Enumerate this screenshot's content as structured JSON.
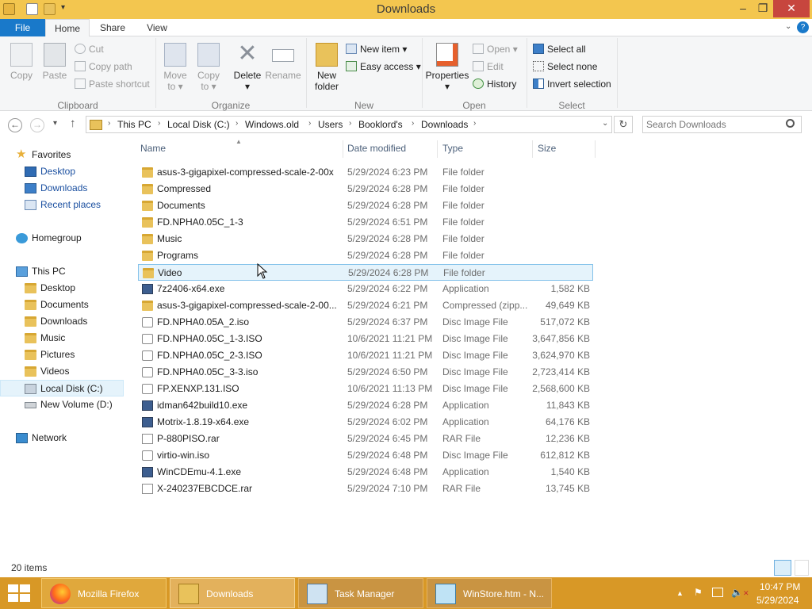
{
  "window": {
    "title": "Downloads",
    "minimize": "–",
    "maximize": "❐",
    "close": "✕"
  },
  "ribbon_tabs": [
    "File",
    "Home",
    "Share",
    "View"
  ],
  "help": "?",
  "ribbon": {
    "clipboard": {
      "copy": "Copy",
      "paste": "Paste",
      "cut": "Cut",
      "copy_path": "Copy path",
      "paste_shortcut": "Paste shortcut",
      "group": "Clipboard"
    },
    "organize": {
      "move_to_1": "Move",
      "move_to_2": "to",
      "copy_to_1": "Copy",
      "copy_to_2": "to",
      "delete": "Delete",
      "rename": "Rename",
      "group": "Organize"
    },
    "new": {
      "new_folder_1": "New",
      "new_folder_2": "folder",
      "new_item": "New item",
      "easy_access": "Easy access",
      "group": "New"
    },
    "open": {
      "properties": "Properties",
      "open": "Open",
      "edit": "Edit",
      "history": "History",
      "group": "Open"
    },
    "select": {
      "select_all": "Select all",
      "select_none": "Select none",
      "invert": "Invert selection",
      "group": "Select"
    }
  },
  "address": {
    "crumbs": [
      "This PC",
      "Local Disk (C:)",
      "Windows.old",
      "Users",
      "Booklord's",
      "Downloads"
    ],
    "search_placeholder": "Search Downloads"
  },
  "nav": {
    "favorites": "Favorites",
    "desktop": "Desktop",
    "downloads": "Downloads",
    "recent": "Recent places",
    "homegroup": "Homegroup",
    "thispc": "This PC",
    "pc_desktop": "Desktop",
    "pc_documents": "Documents",
    "pc_downloads": "Downloads",
    "pc_music": "Music",
    "pc_pictures": "Pictures",
    "pc_videos": "Videos",
    "local_disk": "Local Disk (C:)",
    "new_volume": "New Volume (D:)",
    "network": "Network"
  },
  "columns": {
    "name": "Name",
    "date": "Date modified",
    "type": "Type",
    "size": "Size"
  },
  "files": [
    {
      "name": "asus-3-gigapixel-compressed-scale-2-00x",
      "date": "5/29/2024 6:23 PM",
      "type": "File folder",
      "size": "",
      "icon": "folder"
    },
    {
      "name": "Compressed",
      "date": "5/29/2024 6:28 PM",
      "type": "File folder",
      "size": "",
      "icon": "folder"
    },
    {
      "name": "Documents",
      "date": "5/29/2024 6:28 PM",
      "type": "File folder",
      "size": "",
      "icon": "folder"
    },
    {
      "name": "FD.NPHA0.05C_1-3",
      "date": "5/29/2024 6:51 PM",
      "type": "File folder",
      "size": "",
      "icon": "folder"
    },
    {
      "name": "Music",
      "date": "5/29/2024 6:28 PM",
      "type": "File folder",
      "size": "",
      "icon": "folder"
    },
    {
      "name": "Programs",
      "date": "5/29/2024 6:28 PM",
      "type": "File folder",
      "size": "",
      "icon": "folder"
    },
    {
      "name": "Video",
      "date": "5/29/2024 6:28 PM",
      "type": "File folder",
      "size": "",
      "icon": "folder"
    },
    {
      "name": "7z2406-x64.exe",
      "date": "5/29/2024 6:22 PM",
      "type": "Application",
      "size": "1,582 KB",
      "icon": "app"
    },
    {
      "name": "asus-3-gigapixel-compressed-scale-2-00...",
      "date": "5/29/2024 6:21 PM",
      "type": "Compressed (zipp...",
      "size": "49,649 KB",
      "icon": "folder"
    },
    {
      "name": "FD.NPHA0.05A_2.iso",
      "date": "5/29/2024 6:37 PM",
      "type": "Disc Image File",
      "size": "517,072 KB",
      "icon": "disc"
    },
    {
      "name": "FD.NPHA0.05C_1-3.ISO",
      "date": "10/6/2021 11:21 PM",
      "type": "Disc Image File",
      "size": "3,647,856 KB",
      "icon": "disc"
    },
    {
      "name": "FD.NPHA0.05C_2-3.ISO",
      "date": "10/6/2021 11:21 PM",
      "type": "Disc Image File",
      "size": "3,624,970 KB",
      "icon": "disc"
    },
    {
      "name": "FD.NPHA0.05C_3-3.iso",
      "date": "5/29/2024 6:50 PM",
      "type": "Disc Image File",
      "size": "2,723,414 KB",
      "icon": "disc"
    },
    {
      "name": "FP.XENXP.131.ISO",
      "date": "10/6/2021 11:13 PM",
      "type": "Disc Image File",
      "size": "2,568,600 KB",
      "icon": "disc"
    },
    {
      "name": "idman642build10.exe",
      "date": "5/29/2024 6:28 PM",
      "type": "Application",
      "size": "11,843 KB",
      "icon": "app"
    },
    {
      "name": "Motrix-1.8.19-x64.exe",
      "date": "5/29/2024 6:02 PM",
      "type": "Application",
      "size": "64,176 KB",
      "icon": "app"
    },
    {
      "name": "P-880PISO.rar",
      "date": "5/29/2024 6:45 PM",
      "type": "RAR File",
      "size": "12,236 KB",
      "icon": "doc"
    },
    {
      "name": "virtio-win.iso",
      "date": "5/29/2024 6:48 PM",
      "type": "Disc Image File",
      "size": "612,812 KB",
      "icon": "disc"
    },
    {
      "name": "WinCDEmu-4.1.exe",
      "date": "5/29/2024 6:48 PM",
      "type": "Application",
      "size": "1,540 KB",
      "icon": "app"
    },
    {
      "name": "X-240237EBCDCE.rar",
      "date": "5/29/2024 7:10 PM",
      "type": "RAR File",
      "size": "13,745 KB",
      "icon": "doc"
    }
  ],
  "status": {
    "count": "20 items"
  },
  "taskbar": {
    "firefox": "Mozilla Firefox",
    "downloads": "Downloads",
    "taskmgr": "Task Manager",
    "notepad": "WinStore.htm - N...",
    "time": "10:47 PM",
    "date": "5/29/2024"
  },
  "colors": {
    "titlebar": "#f3c64f",
    "file_tab": "#1979ca",
    "taskbar": "#d89826",
    "selection": "#e5f3fb"
  }
}
